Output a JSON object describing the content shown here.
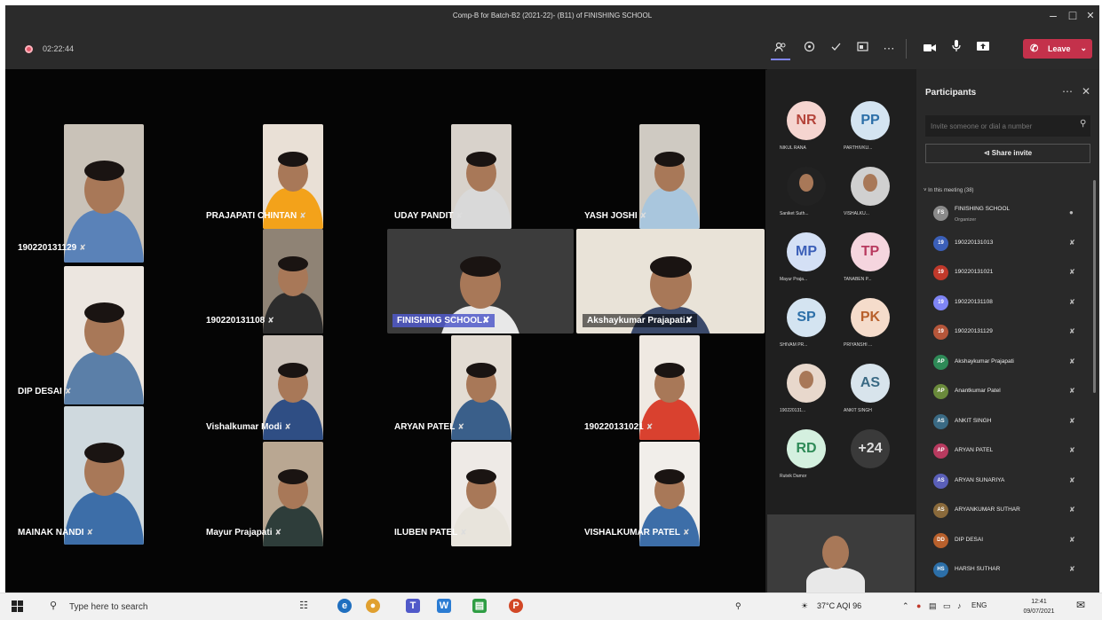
{
  "window": {
    "title": "Comp-B for Batch-B2 (2021-22)- (B11) of FINISHING SCHOOL",
    "minimize": "–",
    "maximize": "□",
    "close": "✕"
  },
  "meeting": {
    "timer": "02:22:44",
    "leave_label": "Leave"
  },
  "stage_tiles": [
    {
      "name": "190220131129",
      "bg": "#c9c2b8",
      "shirt": "#5a82b8"
    },
    {
      "name": "PRAJAPATI CHINTAN",
      "bg": "#e9e0d6",
      "shirt": "#f3a21a"
    },
    {
      "name": "UDAY PANDIT",
      "bg": "#d8d2cb",
      "shirt": "#d9d9d9"
    },
    {
      "name": "YASH JOSHI",
      "bg": "#cfcac2",
      "shirt": "#a9c6dd"
    },
    {
      "name": "DIP DESAI",
      "bg": "#ece6e0",
      "shirt": "#5b7fa8"
    },
    {
      "name": "190220131108",
      "bg": "#8f8375",
      "shirt": "#2c2c2c"
    },
    {
      "name": "Vishalkumar Modi",
      "bg": "#cdc4bb",
      "shirt": "#2f4e84"
    },
    {
      "name": "ARYAN PATEL",
      "bg": "#e3dcd3",
      "shirt": "#3a5f8a"
    },
    {
      "name": "190220131021",
      "bg": "#efe9e2",
      "shirt": "#d9412f"
    },
    {
      "name": "MAINAK NANDI",
      "bg": "#cfd9de",
      "shirt": "#3d6ea8"
    },
    {
      "name": "Mayur Prajapati",
      "bg": "#b9a792",
      "shirt": "#2e3d3a"
    },
    {
      "name": "ILUBEN PATEL",
      "bg": "#eeeae6",
      "shirt": "#e8e4dc"
    },
    {
      "name": "VISHALKUMAR PATEL",
      "bg": "#f1eeea",
      "shirt": "#3d6ea8"
    },
    {
      "name": "FINISHING SCHOOL",
      "bg": "#3c3c3c",
      "shirt": "#e8e8e8"
    },
    {
      "name": "Akshaykumar Prajapati",
      "bg": "#e9e3d8",
      "shirt": "#3b4a6b"
    }
  ],
  "roster": [
    {
      "initials": "NR",
      "label": "NIKUL RANA",
      "bg": "#f5d5d0",
      "fg": "#b4443a",
      "photo": false
    },
    {
      "initials": "PP",
      "label": "PARTHIVKU...",
      "bg": "#d4e4f1",
      "fg": "#2c6fa8",
      "photo": false
    },
    {
      "initials": "",
      "label": "Saniket Suth...",
      "bg": "#222",
      "fg": "#fff",
      "photo": true
    },
    {
      "initials": "",
      "label": "VISHALKU...",
      "bg": "#d0d0d0",
      "fg": "#fff",
      "photo": true
    },
    {
      "initials": "MP",
      "label": "Mayur Praja...",
      "bg": "#d4e0f5",
      "fg": "#3b5fb8",
      "photo": false
    },
    {
      "initials": "TP",
      "label": "TANABEN P...",
      "bg": "#f5d5de",
      "fg": "#b83a5f",
      "photo": false
    },
    {
      "initials": "SP",
      "label": "SHIVAM PR...",
      "bg": "#d4e4f1",
      "fg": "#2c6fa8",
      "photo": false
    },
    {
      "initials": "PK",
      "label": "PRIYANSHI ...",
      "bg": "#f5dccb",
      "fg": "#b8602c",
      "photo": false
    },
    {
      "initials": "",
      "label": "190220131...",
      "bg": "#e8d8cc",
      "fg": "#fff",
      "photo": true
    },
    {
      "initials": "AS",
      "label": "ANKIT SINGH",
      "bg": "#d8e4ec",
      "fg": "#3a6a84",
      "photo": false
    },
    {
      "initials": "RD",
      "label": "Rutvik Damor",
      "bg": "#d4f0df",
      "fg": "#2e8a57",
      "photo": false
    },
    {
      "initials": "+24",
      "label": "",
      "bg": "#3a3a3a",
      "fg": "#ddd",
      "photo": false
    }
  ],
  "panel": {
    "title": "Participants",
    "invite_placeholder": "Invite someone or dial a number",
    "share_label": "Share invite",
    "section_label": "In this meeting (38)",
    "people": [
      {
        "name": "FINISHING SCHOOL",
        "sub": "Organizer",
        "color": "#8a8a8a",
        "initials": "FS"
      },
      {
        "name": "190220131013",
        "sub": "",
        "color": "#3b5fb8",
        "initials": "19"
      },
      {
        "name": "190220131021",
        "sub": "",
        "color": "#c0392b",
        "initials": "19"
      },
      {
        "name": "190220131108",
        "sub": "",
        "color": "#7f85f5",
        "initials": "19"
      },
      {
        "name": "190220131129",
        "sub": "",
        "color": "#b5563a",
        "initials": "19"
      },
      {
        "name": "Akshaykumar Prajapati",
        "sub": "",
        "color": "#2e8a57",
        "initials": "AP"
      },
      {
        "name": "Anantkumar Patel",
        "sub": "",
        "color": "#6a8a3b",
        "initials": "AP"
      },
      {
        "name": "ANKIT SINGH",
        "sub": "",
        "color": "#3a6a84",
        "initials": "AS"
      },
      {
        "name": "ARYAN PATEL",
        "sub": "",
        "color": "#b83a5f",
        "initials": "AP"
      },
      {
        "name": "ARYAN SUNARIYA",
        "sub": "",
        "color": "#5a5fb8",
        "initials": "AS"
      },
      {
        "name": "ARYANKUMAR SUTHAR",
        "sub": "",
        "color": "#8a6a3b",
        "initials": "AS"
      },
      {
        "name": "DIP DESAI",
        "sub": "",
        "color": "#b8602c",
        "initials": "DD"
      },
      {
        "name": "HARSH SUTHAR",
        "sub": "",
        "color": "#2c6fa8",
        "initials": "HS"
      }
    ]
  },
  "taskbar": {
    "search_placeholder": "Type here to search",
    "weather": "37°C AQI 96",
    "lang": "ENG",
    "time": "12:41",
    "date": "09/07/2021"
  }
}
